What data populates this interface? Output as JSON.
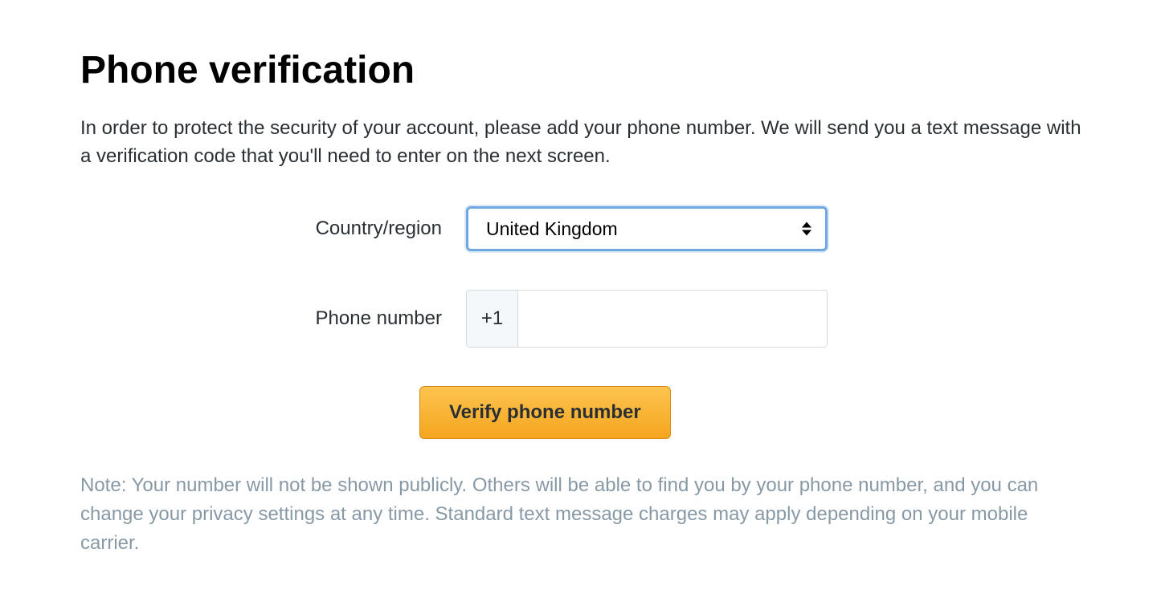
{
  "heading": "Phone verification",
  "description": "In order to protect the security of your account, please add your phone number. We will send you a text message with a verification code that you'll need to enter on the next screen.",
  "form": {
    "country_label": "Country/region",
    "country_value": "United Kingdom",
    "phone_label": "Phone number",
    "phone_prefix": "+1",
    "phone_value": ""
  },
  "button": {
    "verify_label": "Verify phone number"
  },
  "note": "Note: Your number will not be shown publicly. Others will be able to find you by your phone number, and you can change your privacy settings at any time. Standard text message charges may apply depending on your mobile carrier."
}
